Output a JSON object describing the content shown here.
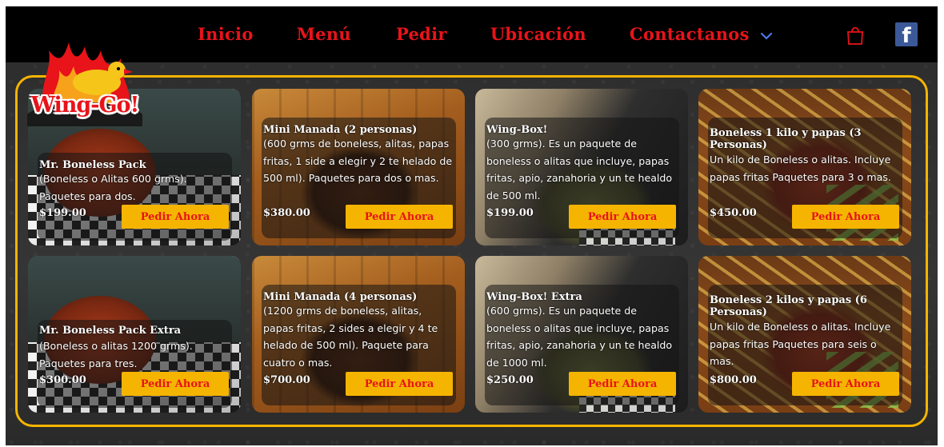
{
  "nav": {
    "links": [
      "Inicio",
      "Menú",
      "Pedir",
      "Ubicación",
      "Contactanos"
    ]
  },
  "logo": {
    "text": "Wing-Go!"
  },
  "icons": {
    "dropdown": "chevron-down-icon",
    "cart": "shopping-bag-icon",
    "facebook": "facebook-icon"
  },
  "colors": {
    "accent_red": "#e8141a",
    "accent_yellow": "#f5b400",
    "facebook": "#3b5998"
  },
  "products": [
    {
      "title": "Mr. Boneless Pack",
      "description": "(Boneless o Alitas 600 grms). Paquetes para dos.",
      "price": "$199.00",
      "button": "Pedir Ahora"
    },
    {
      "title": "Mini Manada (2 personas)",
      "description": "(600 grms de boneless, alitas, papas fritas, 1 side a elegir y 2 te helado de 500 ml). Paquetes para dos o mas.",
      "price": "$380.00",
      "button": "Pedir Ahora"
    },
    {
      "title": "Wing-Box!",
      "description": "(300 grms). Es un paquete de boneless o alitas que incluye, papas fritas, apio, zanahoria y un te healdo de 500 ml.",
      "price": "$199.00",
      "button": "Pedir Ahora"
    },
    {
      "title": "Boneless 1 kilo y papas (3 Personas)",
      "description": "Un kilo de Boneless o alitas. Incluye papas fritas Paquetes para 3 o mas.",
      "price": "$450.00",
      "button": "Pedir Ahora"
    },
    {
      "title": "Mr. Boneless Pack Extra",
      "description": "(Boneless o alitas 1200 grms). Paquetes para tres.",
      "price": "$300.00",
      "button": "Pedir Ahora"
    },
    {
      "title": "Mini Manada (4 personas)",
      "description": "(1200 grms de boneless, alitas, papas fritas, 2 sides a elegir y 4 te helado de 500 ml). Paquete para cuatro o mas.",
      "price": "$700.00",
      "button": "Pedir Ahora"
    },
    {
      "title": "Wing-Box! Extra",
      "description": "(600 grms). Es un paquete de boneless o alitas que incluye, papas fritas, apio, zanahoria y un te healdo de 1000 ml.",
      "price": "$250.00",
      "button": "Pedir Ahora"
    },
    {
      "title": "Boneless 2 kilos y papas (6 Personas)",
      "description": "Un kilo de Boneless o alitas. Incluye papas fritas Paquetes para seis o mas.",
      "price": "$800.00",
      "button": "Pedir Ahora"
    }
  ]
}
